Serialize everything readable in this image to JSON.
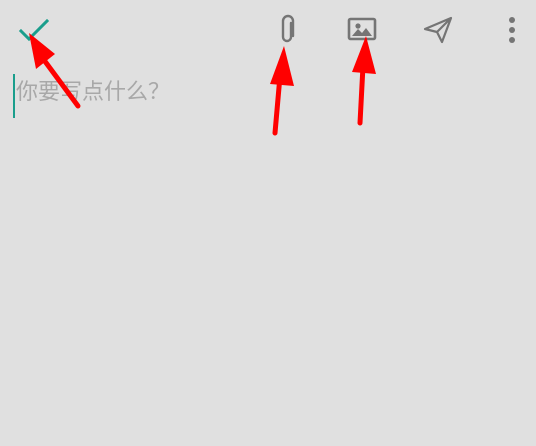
{
  "colors": {
    "background": "#e0e0e0",
    "accent": "#1a9e8c",
    "icon": "#757575",
    "placeholder": "#a8a8a8",
    "annotation": "#ff0000"
  },
  "toolbar": {
    "done": {
      "icon": "check-icon"
    },
    "attach": {
      "icon": "paperclip-icon"
    },
    "image": {
      "icon": "image-icon"
    },
    "send": {
      "icon": "send-icon"
    },
    "more": {
      "icon": "more-vert-icon"
    }
  },
  "compose": {
    "value": "",
    "placeholder": "你要写点什么？"
  },
  "annotations": {
    "arrows": [
      {
        "points_to": "done"
      },
      {
        "points_to": "attach"
      },
      {
        "points_to": "image"
      }
    ]
  }
}
